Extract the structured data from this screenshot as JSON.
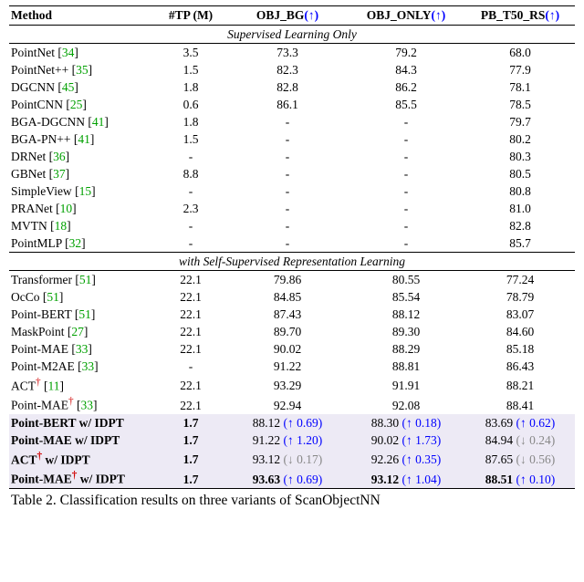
{
  "header": {
    "method": "Method",
    "tp": "#TP (M)",
    "c1": "OBJ_BG",
    "c2": "OBJ_ONLY",
    "c3": "PB_T50_RS",
    "arrow": "(↑)"
  },
  "sections": {
    "supervised": "Supervised Learning Only",
    "ssl": "with Self-Supervised Representation Learning"
  },
  "arrows": {
    "up": "↑",
    "down": "↓"
  },
  "rows_sup": [
    {
      "name": "PointNet",
      "cite": "34",
      "tp": "3.5",
      "c1": "73.3",
      "c2": "79.2",
      "c3": "68.0"
    },
    {
      "name": "PointNet++",
      "cite": "35",
      "tp": "1.5",
      "c1": "82.3",
      "c2": "84.3",
      "c3": "77.9"
    },
    {
      "name": "DGCNN",
      "cite": "45",
      "tp": "1.8",
      "c1": "82.8",
      "c2": "86.2",
      "c3": "78.1"
    },
    {
      "name": "PointCNN",
      "cite": "25",
      "tp": "0.6",
      "c1": "86.1",
      "c2": "85.5",
      "c3": "78.5"
    },
    {
      "name": "BGA-DGCNN",
      "cite": "41",
      "tp": "1.8",
      "c1": "-",
      "c2": "-",
      "c3": "79.7"
    },
    {
      "name": "BGA-PN++",
      "cite": "41",
      "tp": "1.5",
      "c1": "-",
      "c2": "-",
      "c3": "80.2"
    },
    {
      "name": "DRNet",
      "cite": "36",
      "tp": "-",
      "c1": "-",
      "c2": "-",
      "c3": "80.3"
    },
    {
      "name": "GBNet",
      "cite": "37",
      "tp": "8.8",
      "c1": "-",
      "c2": "-",
      "c3": "80.5"
    },
    {
      "name": "SimpleView",
      "cite": "15",
      "tp": "-",
      "c1": "-",
      "c2": "-",
      "c3": "80.8"
    },
    {
      "name": "PRANet",
      "cite": "10",
      "tp": "2.3",
      "c1": "-",
      "c2": "-",
      "c3": "81.0"
    },
    {
      "name": "MVTN",
      "cite": "18",
      "tp": "-",
      "c1": "-",
      "c2": "-",
      "c3": "82.8"
    },
    {
      "name": "PointMLP",
      "cite": "32",
      "tp": "-",
      "c1": "-",
      "c2": "-",
      "c3": "85.7"
    }
  ],
  "rows_ssl": [
    {
      "name": "Transformer",
      "cite": "51",
      "tp": "22.1",
      "c1": "79.86",
      "c2": "80.55",
      "c3": "77.24"
    },
    {
      "name": "OcCo",
      "cite": "51",
      "tp": "22.1",
      "c1": "84.85",
      "c2": "85.54",
      "c3": "78.79"
    },
    {
      "name": "Point-BERT",
      "cite": "51",
      "tp": "22.1",
      "c1": "87.43",
      "c2": "88.12",
      "c3": "83.07"
    },
    {
      "name": "MaskPoint",
      "cite": "27",
      "tp": "22.1",
      "c1": "89.70",
      "c2": "89.30",
      "c3": "84.60"
    },
    {
      "name": "Point-MAE",
      "cite": "33",
      "tp": "22.1",
      "c1": "90.02",
      "c2": "88.29",
      "c3": "85.18"
    },
    {
      "name": "Point-M2AE",
      "cite": "33",
      "tp": "-",
      "c1": "91.22",
      "c2": "88.81",
      "c3": "86.43"
    },
    {
      "name": "ACT",
      "dagger": true,
      "cite": "11",
      "tp": "22.1",
      "c1": "93.29",
      "c2": "91.91",
      "c3": "88.21"
    },
    {
      "name": "Point-MAE",
      "dagger": true,
      "cite": "33",
      "tp": "22.1",
      "c1": "92.94",
      "c2": "92.08",
      "c3": "88.41"
    }
  ],
  "rows_idpt": [
    {
      "name": "Point-BERT w/ IDPT",
      "tp": "1.7",
      "c1": "88.12",
      "d1": {
        "dir": "up",
        "v": "0.69"
      },
      "c2": "88.30",
      "d2": {
        "dir": "up",
        "v": "0.18"
      },
      "c3": "83.69",
      "d3": {
        "dir": "up",
        "v": "0.62"
      }
    },
    {
      "name": "Point-MAE w/ IDPT",
      "tp": "1.7",
      "c1": "91.22",
      "d1": {
        "dir": "up",
        "v": "1.20"
      },
      "c2": "90.02",
      "d2": {
        "dir": "up",
        "v": "1.73"
      },
      "c3": "84.94",
      "d3": {
        "dir": "down",
        "v": "0.24"
      }
    },
    {
      "name": "ACT",
      "dagger": true,
      "suffix": " w/ IDPT",
      "tp": "1.7",
      "c1": "93.12",
      "d1": {
        "dir": "down",
        "v": "0.17"
      },
      "c2": "92.26",
      "d2": {
        "dir": "up",
        "v": "0.35"
      },
      "c3": "87.65",
      "d3": {
        "dir": "down",
        "v": "0.56"
      }
    },
    {
      "name": "Point-MAE",
      "dagger": true,
      "suffix": " w/ IDPT",
      "tp": "1.7",
      "c1": "93.63",
      "d1": {
        "dir": "up",
        "v": "0.69"
      },
      "c2": "93.12",
      "d2": {
        "dir": "up",
        "v": "1.04"
      },
      "c3": "88.51",
      "d3": {
        "dir": "up",
        "v": "0.10"
      },
      "bold_all": true
    }
  ],
  "caption": "Table 2. Classification results on three variants of ScanObjectNN"
}
